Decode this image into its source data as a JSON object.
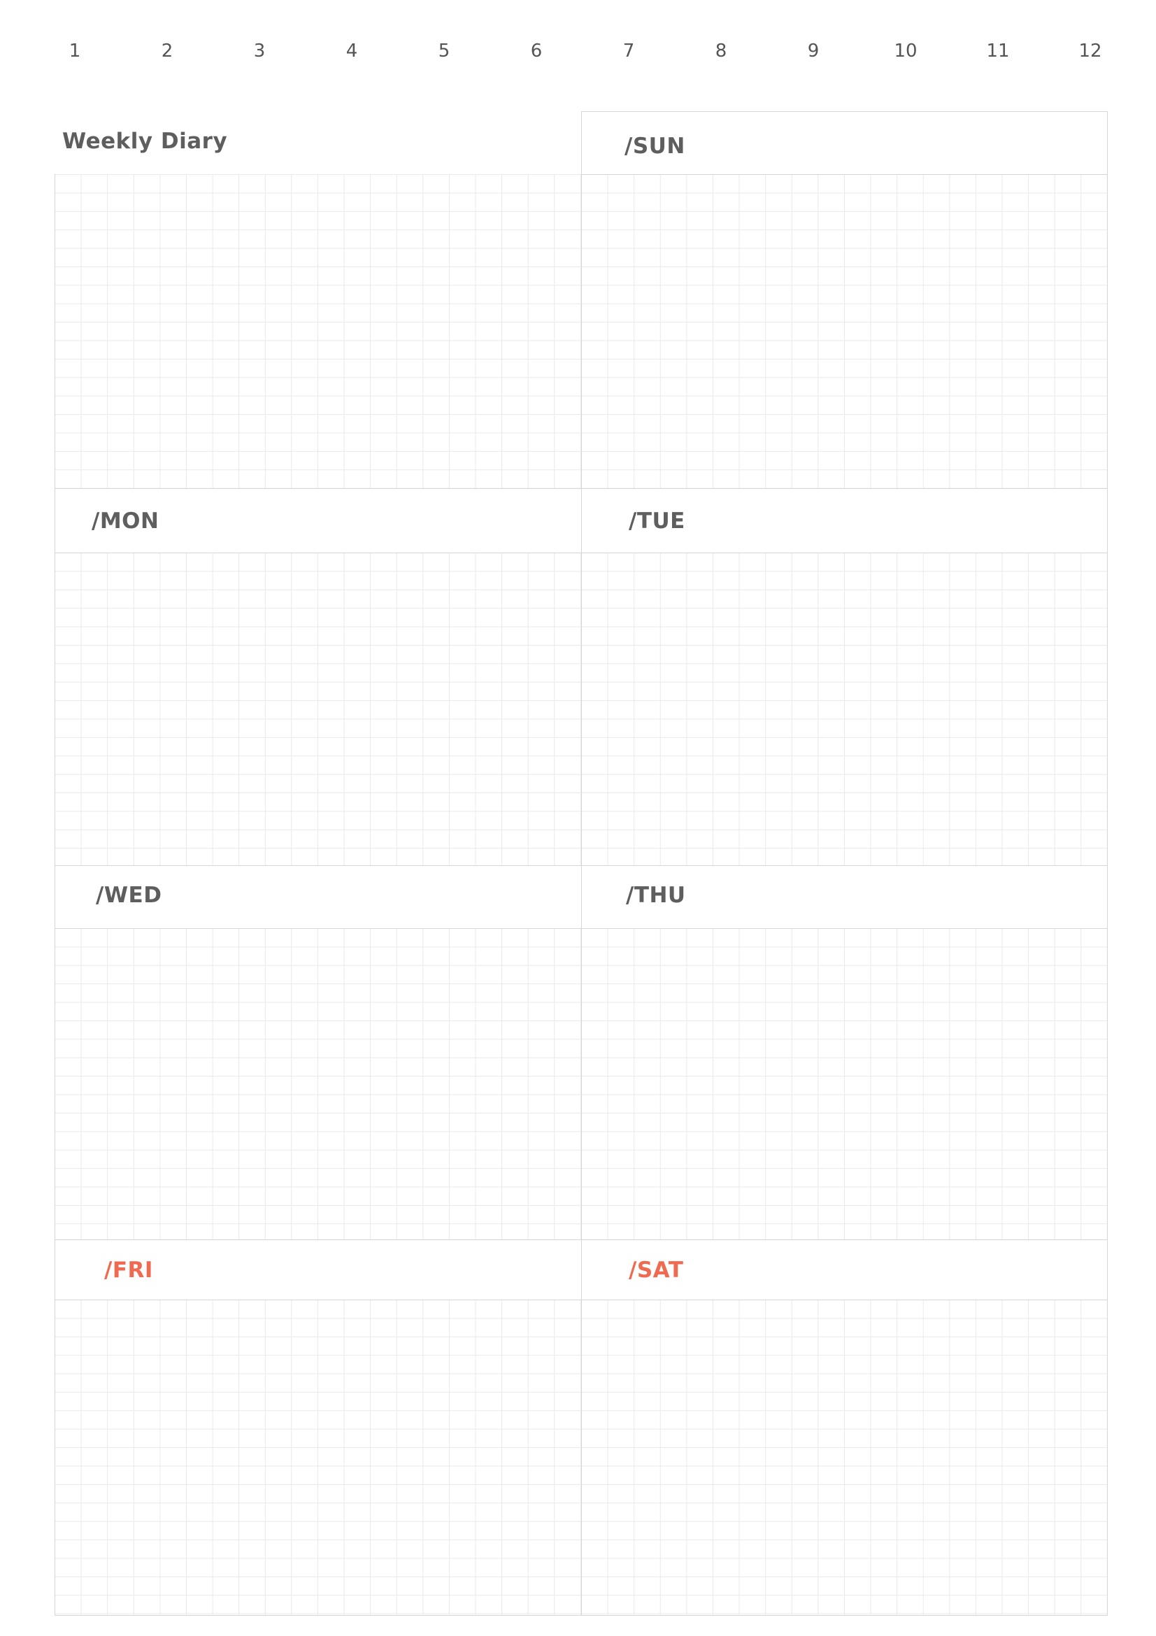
{
  "month_numbers": [
    "1",
    "2",
    "3",
    "4",
    "5",
    "6",
    "7",
    "8",
    "9",
    "10",
    "11",
    "12"
  ],
  "title": "Weekly Diary",
  "days": {
    "sun": "/SUN",
    "mon": "/MON",
    "tue": "/TUE",
    "wed": "/WED",
    "thu": "/THU",
    "fri": "/FRI",
    "sat": "/SAT"
  },
  "colors": {
    "text": "#5e5e5e",
    "weekend": "#ef6a50",
    "grid": "#e9e9e9",
    "border": "#d6d6d6"
  }
}
